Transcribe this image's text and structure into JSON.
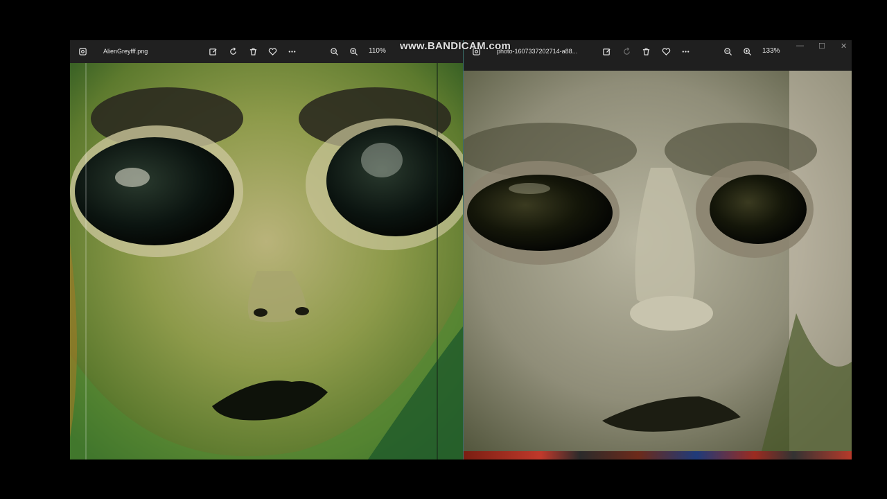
{
  "watermark": {
    "text": "www.BANDICAM.com"
  },
  "left_viewer": {
    "filename": "AlienGreyfff.png",
    "zoom": "110%",
    "toolbar_icons": [
      "app-icon",
      "edit-icon",
      "rotate-icon",
      "delete-icon",
      "favorite-icon",
      "more-icon",
      "zoom-out-icon",
      "zoom-in-icon"
    ]
  },
  "right_viewer": {
    "filename": "photo-1607337202714-a88...",
    "zoom": "133%",
    "window_controls": {
      "minimize": "—",
      "maximize": "☐",
      "close": "✕"
    }
  },
  "colors": {
    "toolbar_bg": "#202020",
    "divider": "#3a6f6a",
    "left_image_tint": "#7a8a3a",
    "right_image_tint": "#8a8a78"
  }
}
